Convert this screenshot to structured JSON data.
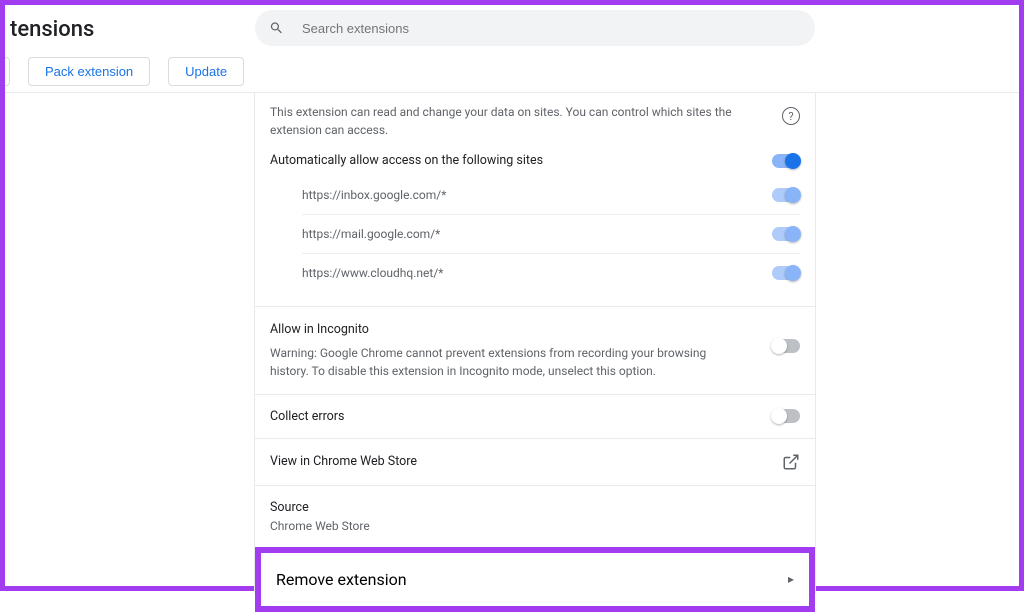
{
  "header": {
    "title_fragment": "tensions",
    "search_placeholder": "Search extensions",
    "pack_label": "Pack extension",
    "update_label": "Update"
  },
  "siteAccess": {
    "desc": "This extension can read and change your data on sites. You can control which sites the extension can access.",
    "auto_label": "Automatically allow access on the following sites",
    "sites": {
      "s0": "https://inbox.google.com/*",
      "s1": "https://mail.google.com/*",
      "s2": "https://www.cloudhq.net/*"
    }
  },
  "incognito": {
    "title": "Allow in Incognito",
    "desc": "Warning: Google Chrome cannot prevent extensions from recording your browsing history. To disable this extension in Incognito mode, unselect this option."
  },
  "collect": {
    "label": "Collect errors"
  },
  "viewStore": {
    "label": "View in Chrome Web Store"
  },
  "source": {
    "title": "Source",
    "value": "Chrome Web Store"
  },
  "remove": {
    "label": "Remove extension"
  }
}
